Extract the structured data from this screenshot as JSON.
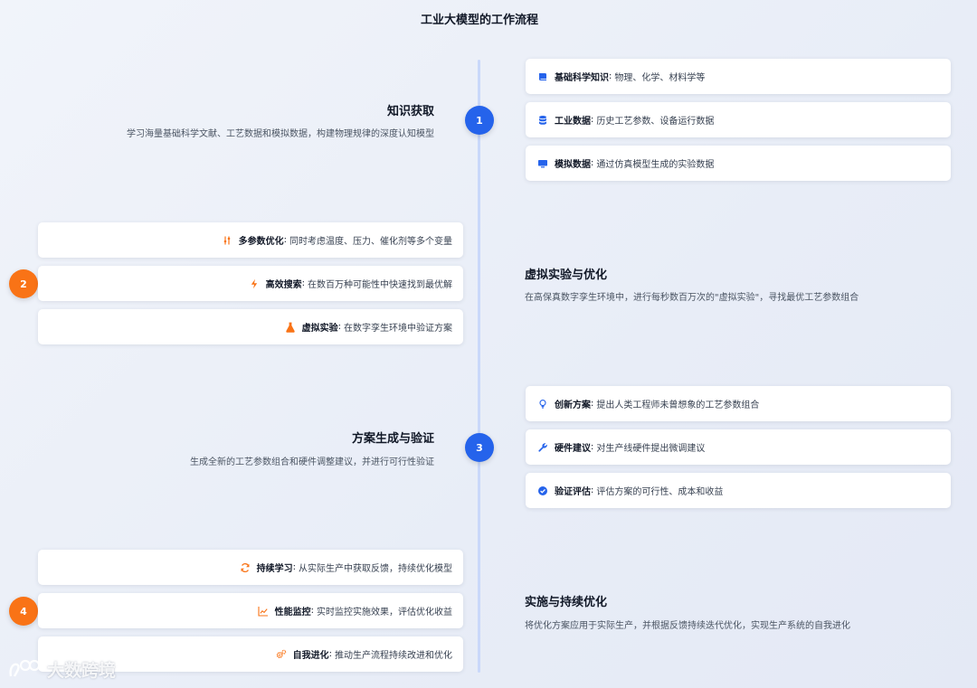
{
  "title": "工业大模型的工作流程",
  "colors": {
    "blue": "#2563eb",
    "orange": "#f97316",
    "line": "#c9d8fa"
  },
  "stages": [
    {
      "number": "1",
      "title": "知识获取",
      "description": "学习海量基础科学文献、工艺数据和模拟数据，构建物理规律的深度认知模型",
      "items": [
        {
          "icon": "book-icon",
          "label": "基础科学知识",
          "text": "物理、化学、材料学等"
        },
        {
          "icon": "database-icon",
          "label": "工业数据",
          "text": "历史工艺参数、设备运行数据"
        },
        {
          "icon": "monitor-icon",
          "label": "模拟数据",
          "text": "通过仿真模型生成的实验数据"
        }
      ]
    },
    {
      "number": "2",
      "title": "虚拟实验与优化",
      "description": "在高保真数字孪生环境中，进行每秒数百万次的\"虚拟实验\"，寻找最优工艺参数组合",
      "items": [
        {
          "icon": "sliders-icon",
          "label": "多参数优化",
          "text": "同时考虑温度、压力、催化剂等多个变量"
        },
        {
          "icon": "bolt-icon",
          "label": "高效搜索",
          "text": "在数百万种可能性中快速找到最优解"
        },
        {
          "icon": "flask-icon",
          "label": "虚拟实验",
          "text": "在数字孪生环境中验证方案"
        }
      ]
    },
    {
      "number": "3",
      "title": "方案生成与验证",
      "description": "生成全新的工艺参数组合和硬件调整建议，并进行可行性验证",
      "items": [
        {
          "icon": "lightbulb-icon",
          "label": "创新方案",
          "text": "提出人类工程师未曾想象的工艺参数组合"
        },
        {
          "icon": "wrench-icon",
          "label": "硬件建议",
          "text": "对生产线硬件提出微调建议"
        },
        {
          "icon": "check-circle-icon",
          "label": "验证评估",
          "text": "评估方案的可行性、成本和收益"
        }
      ]
    },
    {
      "number": "4",
      "title": "实施与持续优化",
      "description": "将优化方案应用于实际生产，并根据反馈持续迭代优化，实现生产系统的自我进化",
      "items": [
        {
          "icon": "sync-icon",
          "label": "持续学习",
          "text": "从实际生产中获取反馈，持续优化模型"
        },
        {
          "icon": "chart-line-icon",
          "label": "性能监控",
          "text": "实时监控实施效果，评估优化收益"
        },
        {
          "icon": "cogs-icon",
          "label": "自我进化",
          "text": "推动生产流程持续改进和优化"
        }
      ]
    }
  ],
  "watermark": "大数跨境"
}
